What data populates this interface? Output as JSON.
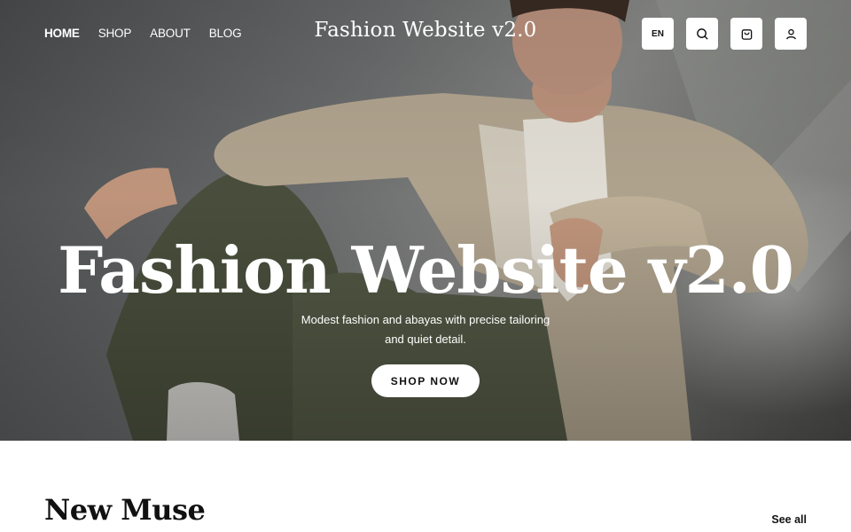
{
  "header": {
    "nav": [
      {
        "label": "HOME",
        "active": true
      },
      {
        "label": "SHOP",
        "active": false
      },
      {
        "label": "ABOUT",
        "active": false
      },
      {
        "label": "BLOG",
        "active": false
      }
    ],
    "site_title": "Fashion Website v2.0",
    "language_label": "EN",
    "icons": [
      "search-icon",
      "cart-icon",
      "user-icon"
    ]
  },
  "hero": {
    "heading": "Fashion Website v2.0",
    "subtitle": "Modest fashion and abayas with precise tailoring and quiet detail.",
    "cta_label": "SHOP NOW"
  },
  "section": {
    "title": "New Muse",
    "see_all_label": "See all"
  },
  "colors": {
    "button_bg": "#ffffff",
    "text_dark": "#111111",
    "hero_text": "#ffffff"
  }
}
